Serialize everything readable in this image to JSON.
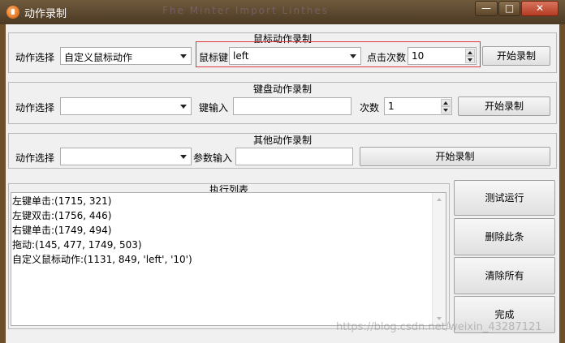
{
  "window": {
    "title": "动作录制",
    "minimize_label": "—",
    "maximize_label": "□",
    "close_label": "✕",
    "background_text": "Fhe Minter Import Linthes"
  },
  "mouse_section": {
    "title": "鼠标动作录制",
    "action_label": "动作选择",
    "action_value": "自定义鼠标动作",
    "key_label": "鼠标键",
    "key_value": "left",
    "count_label": "点击次数",
    "count_value": "10",
    "record_button": "开始录制"
  },
  "keyboard_section": {
    "title": "键盘动作录制",
    "action_label": "动作选择",
    "action_value": "",
    "key_input_label": "键输入",
    "key_input_value": "",
    "count_label": "次数",
    "count_value": "1",
    "record_button": "开始录制"
  },
  "other_section": {
    "title": "其他动作录制",
    "action_label": "动作选择",
    "action_value": "",
    "param_label": "参数输入",
    "param_value": "",
    "record_button": "开始录制"
  },
  "execution_list": {
    "title": "执行列表",
    "items": [
      "左键单击:(1715, 321)",
      "左键双击:(1756, 446)",
      "右键单击:(1749, 494)",
      "拖动:(145, 477, 1749, 503)",
      "自定义鼠标动作:(1131, 849, 'left', '10')"
    ]
  },
  "side_buttons": {
    "test_run": "测试运行",
    "delete_item": "删除此条",
    "clear_all": "清除所有",
    "done": "完成"
  },
  "watermark": "https://blog.csdn.net/weixin_43287121",
  "colors": {
    "title_bar": "#5a4530",
    "close_button": "#c9513a",
    "highlight_border": "#e0343c"
  }
}
